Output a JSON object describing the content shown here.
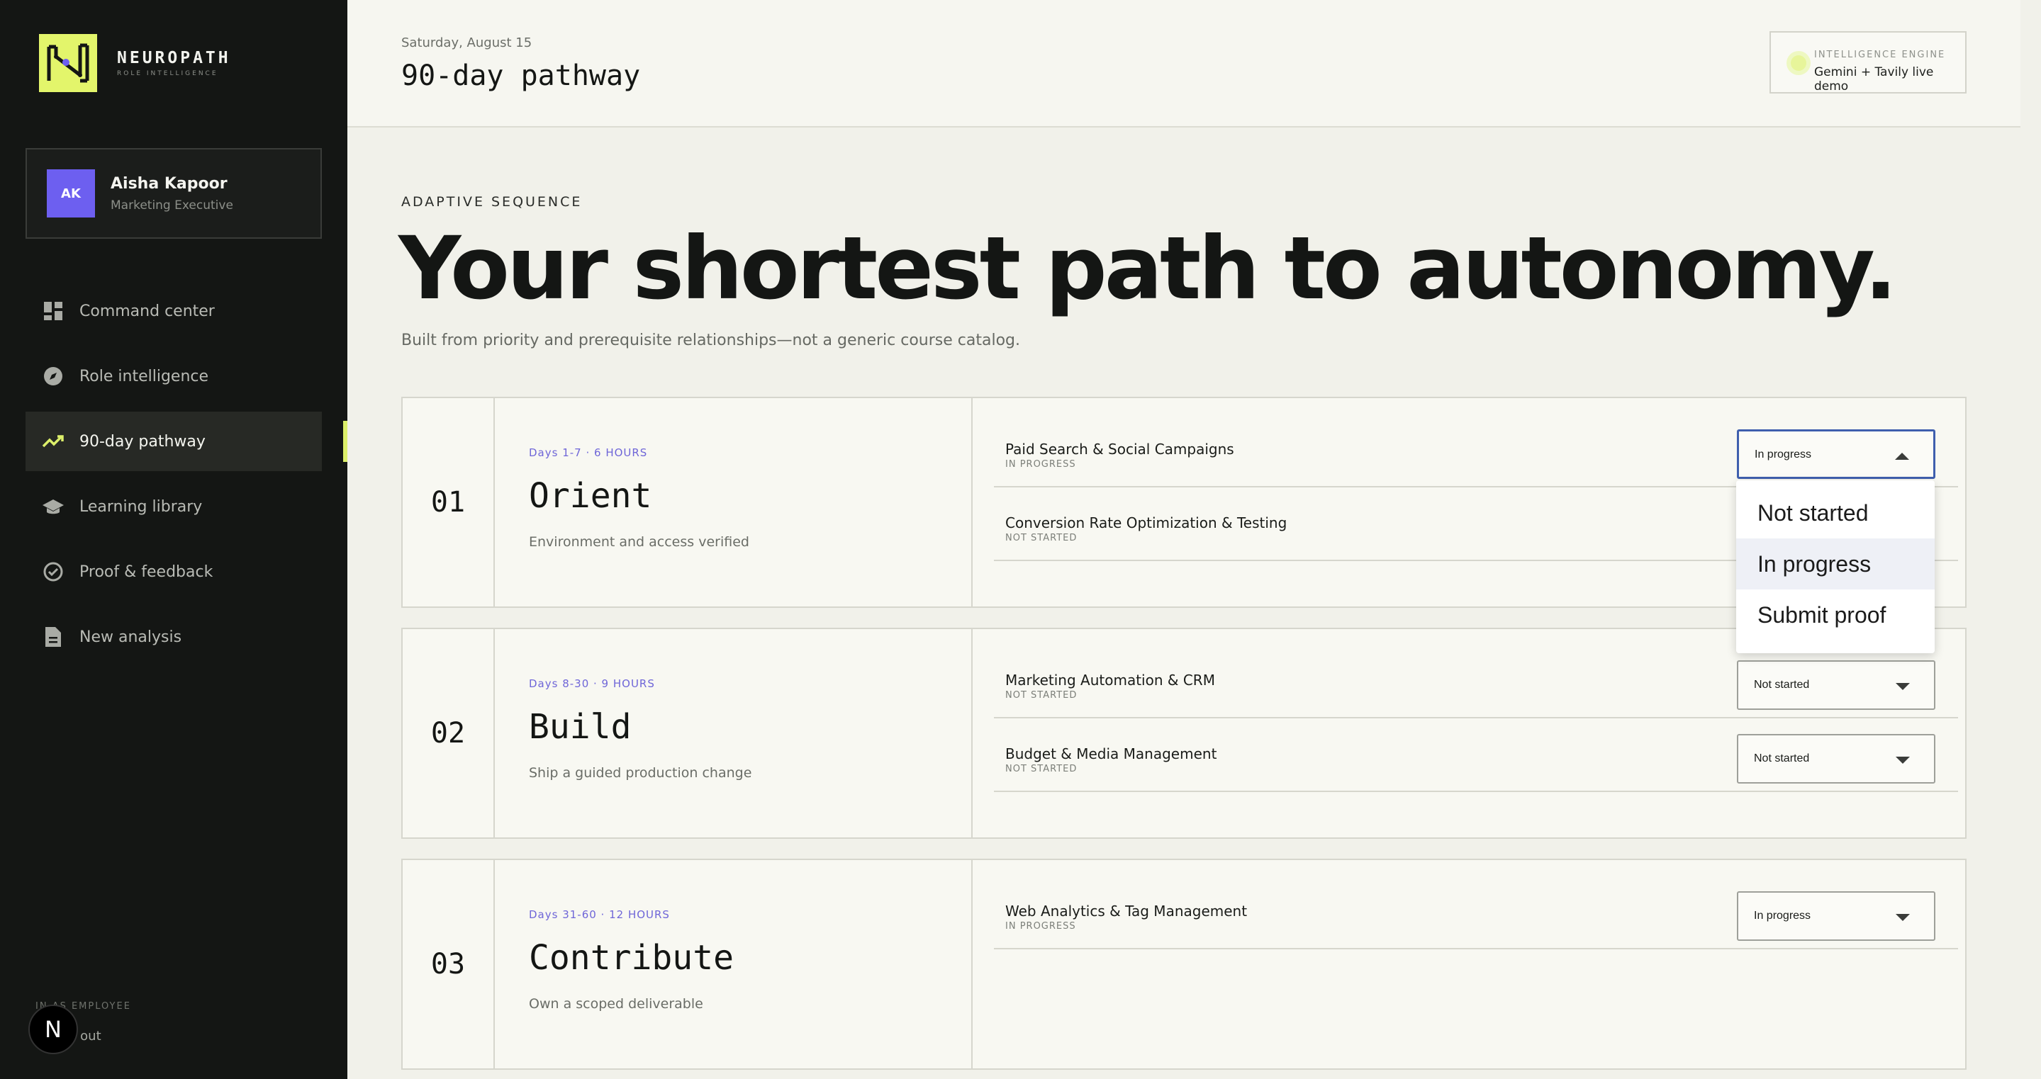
{
  "brand": {
    "name": "NEUROPATH",
    "tagline": "ROLE INTELLIGENCE"
  },
  "user": {
    "initials": "AK",
    "name": "Aisha Kapoor",
    "role": "Marketing Executive"
  },
  "nav": {
    "items": [
      {
        "label": "Command center",
        "icon": "dashboard-icon"
      },
      {
        "label": "Role intelligence",
        "icon": "compass-icon"
      },
      {
        "label": "90-day pathway",
        "icon": "trending-up-icon"
      },
      {
        "label": "Learning library",
        "icon": "graduation-cap-icon"
      },
      {
        "label": "Proof & feedback",
        "icon": "check-circle-icon"
      },
      {
        "label": "New analysis",
        "icon": "document-icon"
      }
    ],
    "active_index": 2
  },
  "footer": {
    "signed_in": "IN AS EMPLOYEE",
    "logout": "g out",
    "badge": "N"
  },
  "header": {
    "date": "Saturday, August 15",
    "title": "90-day pathway",
    "engine_label": "INTELLIGENCE ENGINE",
    "engine_value": "Gemini + Tavily live demo"
  },
  "hero": {
    "eyebrow": "ADAPTIVE SEQUENCE",
    "headline": "Your shortest path to autonomy.",
    "subline": "Built from priority and prerequisite relationships—not a generic course catalog."
  },
  "phases": [
    {
      "number": "01",
      "meta": "Days 1-7 · 6 HOURS",
      "name": "Orient",
      "description": "Environment and access verified",
      "tasks": [
        {
          "name": "Paid Search & Social Campaigns",
          "status": "IN PROGRESS",
          "select": "In progress"
        },
        {
          "name": "Conversion Rate Optimization & Testing",
          "status": "NOT STARTED",
          "select": "Not started"
        }
      ]
    },
    {
      "number": "02",
      "meta": "Days 8-30 · 9 HOURS",
      "name": "Build",
      "description": "Ship a guided production change",
      "tasks": [
        {
          "name": "Marketing Automation & CRM",
          "status": "NOT STARTED",
          "select": "Not started"
        },
        {
          "name": "Budget & Media Management",
          "status": "NOT STARTED",
          "select": "Not started"
        }
      ]
    },
    {
      "number": "03",
      "meta": "Days 31-60 · 12 HOURS",
      "name": "Contribute",
      "description": "Own a scoped deliverable",
      "tasks": [
        {
          "name": "Web Analytics & Tag Management",
          "status": "IN PROGRESS",
          "select": "In progress"
        }
      ]
    }
  ],
  "dropdown": {
    "options": [
      "Not started",
      "In progress",
      "Submit proof"
    ],
    "highlighted": 1
  },
  "colors": {
    "accent": "#e3f56b",
    "avatar": "#6d5ff0",
    "meta_text": "#6f66d8",
    "sidebar_bg": "#141614"
  }
}
